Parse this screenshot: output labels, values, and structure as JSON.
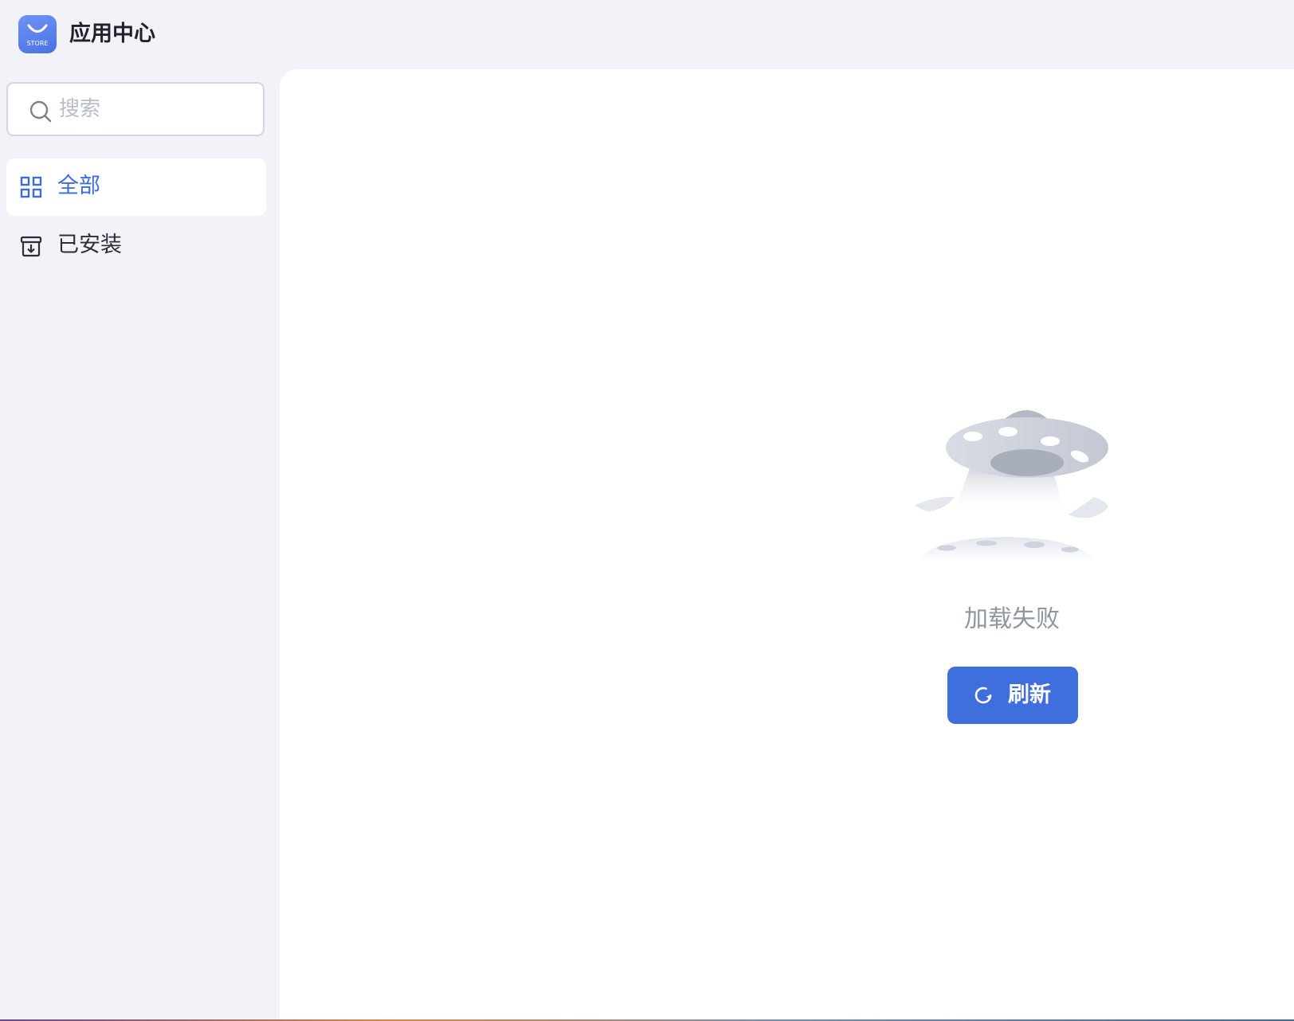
{
  "app": {
    "title": "应用中心",
    "logo_text": "STORE",
    "logo_icon": "shopping-bag-icon"
  },
  "sidebar": {
    "search": {
      "placeholder": "搜索",
      "value": "",
      "icon": "search-icon"
    },
    "items": [
      {
        "label": "全部",
        "icon": "grid-icon",
        "active": true
      },
      {
        "label": "已安装",
        "icon": "installed-box-icon",
        "active": false
      }
    ]
  },
  "main": {
    "empty_state": {
      "illustration": "ufo-illustration",
      "message": "加载失败",
      "button": {
        "label": "刷新",
        "icon": "refresh-icon"
      }
    }
  },
  "colors": {
    "accent": "#3f6fdc",
    "active_nav_text": "#3d6bdc",
    "background": "#f2f3f8",
    "panel": "#ffffff",
    "muted_text": "#8f96a3"
  }
}
